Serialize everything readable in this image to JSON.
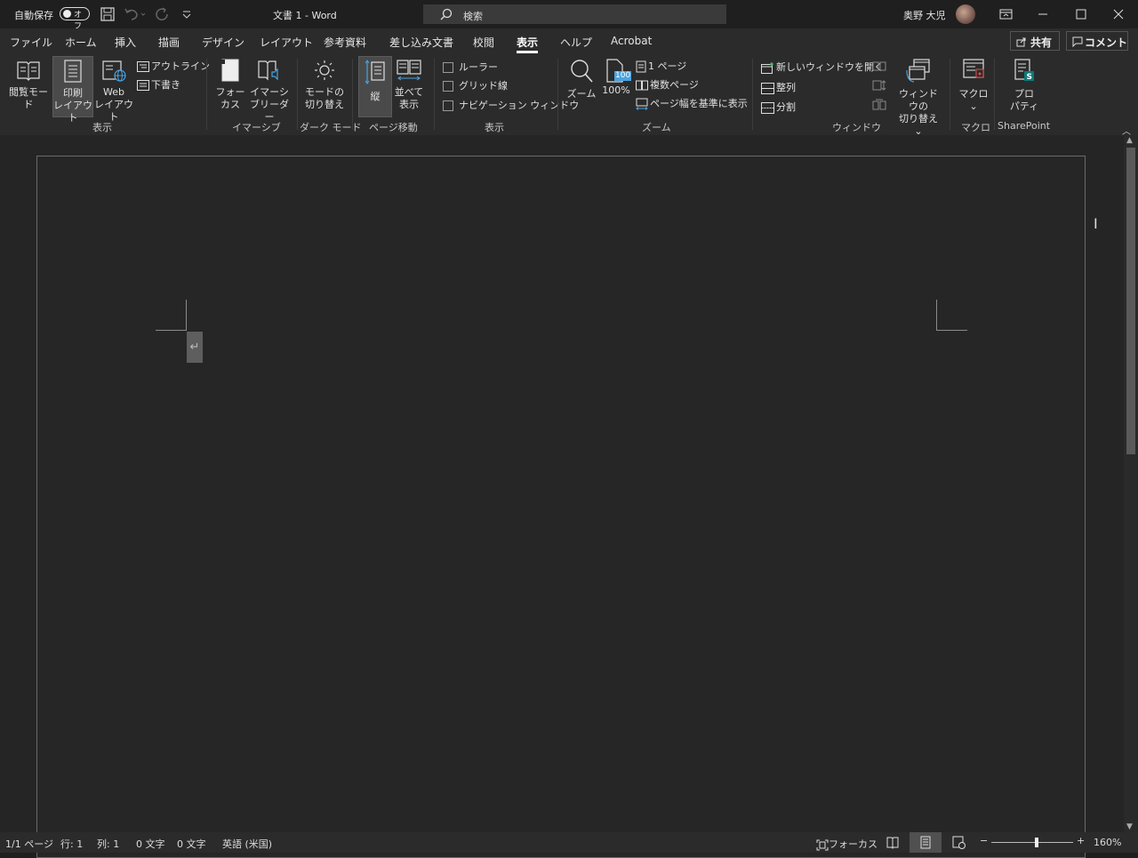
{
  "titlebar": {
    "autosave_label": "自動保存",
    "autosave_state": "オフ",
    "doc_title": "文書 1  -  Word",
    "search_placeholder": "検索",
    "user_name": "奥野 大児"
  },
  "tabs": [
    {
      "label": "ファイル"
    },
    {
      "label": "ホーム"
    },
    {
      "label": "挿入"
    },
    {
      "label": "描画"
    },
    {
      "label": "デザイン"
    },
    {
      "label": "レイアウト"
    },
    {
      "label": "参考資料"
    },
    {
      "label": "差し込み文書"
    },
    {
      "label": "校閲"
    },
    {
      "label": "表示",
      "active": true
    },
    {
      "label": "ヘルプ"
    },
    {
      "label": "Acrobat"
    }
  ],
  "header_buttons": {
    "share": "共有",
    "comment": "コメント"
  },
  "ribbon": {
    "views": {
      "read_mode_1": "閲覧モード",
      "print_layout_1": "印刷",
      "print_layout_2": "レイアウト",
      "web_layout_1": "Web",
      "web_layout_2": "レイアウト",
      "outline": "アウトライン",
      "draft": "下書き",
      "group": "表示"
    },
    "immersive": {
      "focus_1": "フォー",
      "focus_2": "カス",
      "reader_1": "イマーシ",
      "reader_2": "ブリーダー",
      "group": "イマーシブ"
    },
    "dark_mode": {
      "switch_1": "モードの",
      "switch_2": "切り替え",
      "group": "ダーク モード"
    },
    "page_movement": {
      "vertical": "縦",
      "side_by_side_1": "並べて",
      "side_by_side_2": "表示",
      "group": "ページ移動"
    },
    "show": {
      "ruler": "ルーラー",
      "gridlines": "グリッド線",
      "navigation": "ナビゲーション ウィンドウ",
      "group": "表示"
    },
    "zoom": {
      "zoom": "ズーム",
      "hundred": "100%",
      "badge": "100",
      "one_page": "1 ページ",
      "multi_page": "複数ページ",
      "page_width": "ページ幅を基準に表示",
      "group": "ズーム"
    },
    "window": {
      "new_window": "新しいウィンドウを開く",
      "arrange": "整列",
      "split": "分割",
      "switch_1": "ウィンドウの",
      "switch_2": "切り替え",
      "group": "ウィンドウ"
    },
    "macros": {
      "label": "マクロ",
      "group": "マクロ"
    },
    "sharepoint": {
      "label_1": "プロ",
      "label_2": "パティ",
      "group": "SharePoint"
    }
  },
  "statusbar": {
    "page": "1/1 ページ",
    "line": "行: 1",
    "column": "列: 1",
    "chars1": "0 文字",
    "chars2": "0 文字",
    "language": "英語 (米国)",
    "focus": "フォーカス",
    "zoom_level": "160%"
  },
  "colors": {
    "background": "#1f1f1f",
    "ribbon": "#2b2b2b",
    "canvas": "#252525",
    "accent": "#4aa3df"
  }
}
